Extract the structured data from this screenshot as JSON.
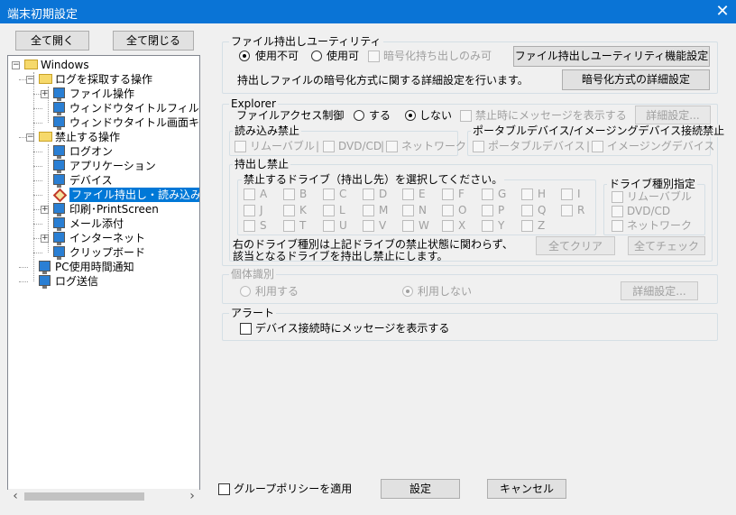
{
  "window": {
    "title": "端末初期設定",
    "close_glyph": "✕"
  },
  "left": {
    "expand_all": "全て開く",
    "collapse_all": "全て閉じる",
    "tree": [
      {
        "label": "Windows",
        "level": 0,
        "icon": "folder-icon",
        "expander": "−"
      },
      {
        "label": "ログを採取する操作",
        "level": 1,
        "icon": "folder-icon",
        "expander": "−"
      },
      {
        "label": "ファイル操作",
        "level": 2,
        "icon": "computer-icon",
        "expander": "+"
      },
      {
        "label": "ウィンドウタイトルフィルタ",
        "level": 2,
        "icon": "computer-icon",
        "expander": ""
      },
      {
        "label": "ウィンドウタイトル画面キャ",
        "level": 2,
        "icon": "computer-icon",
        "expander": ""
      },
      {
        "label": "禁止する操作",
        "level": 1,
        "icon": "folder-icon",
        "expander": "−"
      },
      {
        "label": "ログオン",
        "level": 2,
        "icon": "computer-icon",
        "expander": ""
      },
      {
        "label": "アプリケーション",
        "level": 2,
        "icon": "computer-icon",
        "expander": ""
      },
      {
        "label": "デバイス",
        "level": 2,
        "icon": "computer-icon",
        "expander": ""
      },
      {
        "label": "ファイル持出し・読み込み",
        "level": 2,
        "icon": "diamond-icon",
        "expander": "",
        "selected": true
      },
      {
        "label": "印刷･PrintScreen",
        "level": 2,
        "icon": "computer-icon",
        "expander": "+"
      },
      {
        "label": "メール添付",
        "level": 2,
        "icon": "computer-icon",
        "expander": ""
      },
      {
        "label": "インターネット",
        "level": 2,
        "icon": "computer-icon",
        "expander": "+"
      },
      {
        "label": "クリップボード",
        "level": 2,
        "icon": "computer-icon",
        "expander": ""
      },
      {
        "label": "PC使用時間通知",
        "level": 1,
        "icon": "computer-icon",
        "expander": ""
      },
      {
        "label": "ログ送信",
        "level": 1,
        "icon": "computer-icon",
        "expander": ""
      }
    ],
    "scroll_left": "‹",
    "scroll_right": "›"
  },
  "utility": {
    "legend": "ファイル持出しユーティリティ",
    "opt_disable": "使用不可",
    "opt_enable": "使用可",
    "opt_encrypt_only": "暗号化持ち出しのみ可",
    "settings_button": "ファイル持出しユーティリティ機能設定",
    "desc": "持出しファイルの暗号化方式に関する詳細設定を行います。",
    "encrypt_button": "暗号化方式の詳細設定"
  },
  "explorer": {
    "legend": "Explorer",
    "access_label": "ファイルアクセス制御",
    "opt_on": "する",
    "opt_off": "しない",
    "show_msg": "禁止時にメッセージを表示する",
    "detail_button": "詳細設定...",
    "read_group": "読み込み禁止",
    "read_items": [
      "リムーバブル",
      "DVD/CD",
      "ネットワーク"
    ],
    "portable_group": "ポータブルデバイス/イメージングデバイス接続禁止",
    "portable_items": [
      "ポータブルデバイス",
      "イメージングデバイス"
    ],
    "takeout_group": "持出し禁止",
    "drive_group": "禁止するドライブ（持出し先）を選択してください。",
    "drives": [
      "A",
      "B",
      "C",
      "D",
      "E",
      "F",
      "G",
      "H",
      "I",
      "J",
      "K",
      "L",
      "M",
      "N",
      "O",
      "P",
      "Q",
      "R",
      "S",
      "T",
      "U",
      "V",
      "W",
      "X",
      "Y",
      "Z"
    ],
    "type_group": "ドライブ種別指定",
    "type_items": [
      "リムーバブル",
      "DVD/CD",
      "ネットワーク"
    ],
    "note1": "右のドライブ種別は上記ドライブの禁止状態に関わらず、",
    "note2": "該当となるドライブを持出し禁止にします。",
    "clear_button": "全てクリア",
    "check_button": "全てチェック"
  },
  "identity": {
    "legend": "個体識別",
    "opt_use": "利用する",
    "opt_nouse": "利用しない",
    "detail_button": "詳細設定..."
  },
  "alert": {
    "legend": "アラート",
    "show_msg": "デバイス接続時にメッセージを表示する"
  },
  "footer": {
    "group_policy": "グループポリシーを適用",
    "ok": "設定",
    "cancel": "キャンセル"
  }
}
